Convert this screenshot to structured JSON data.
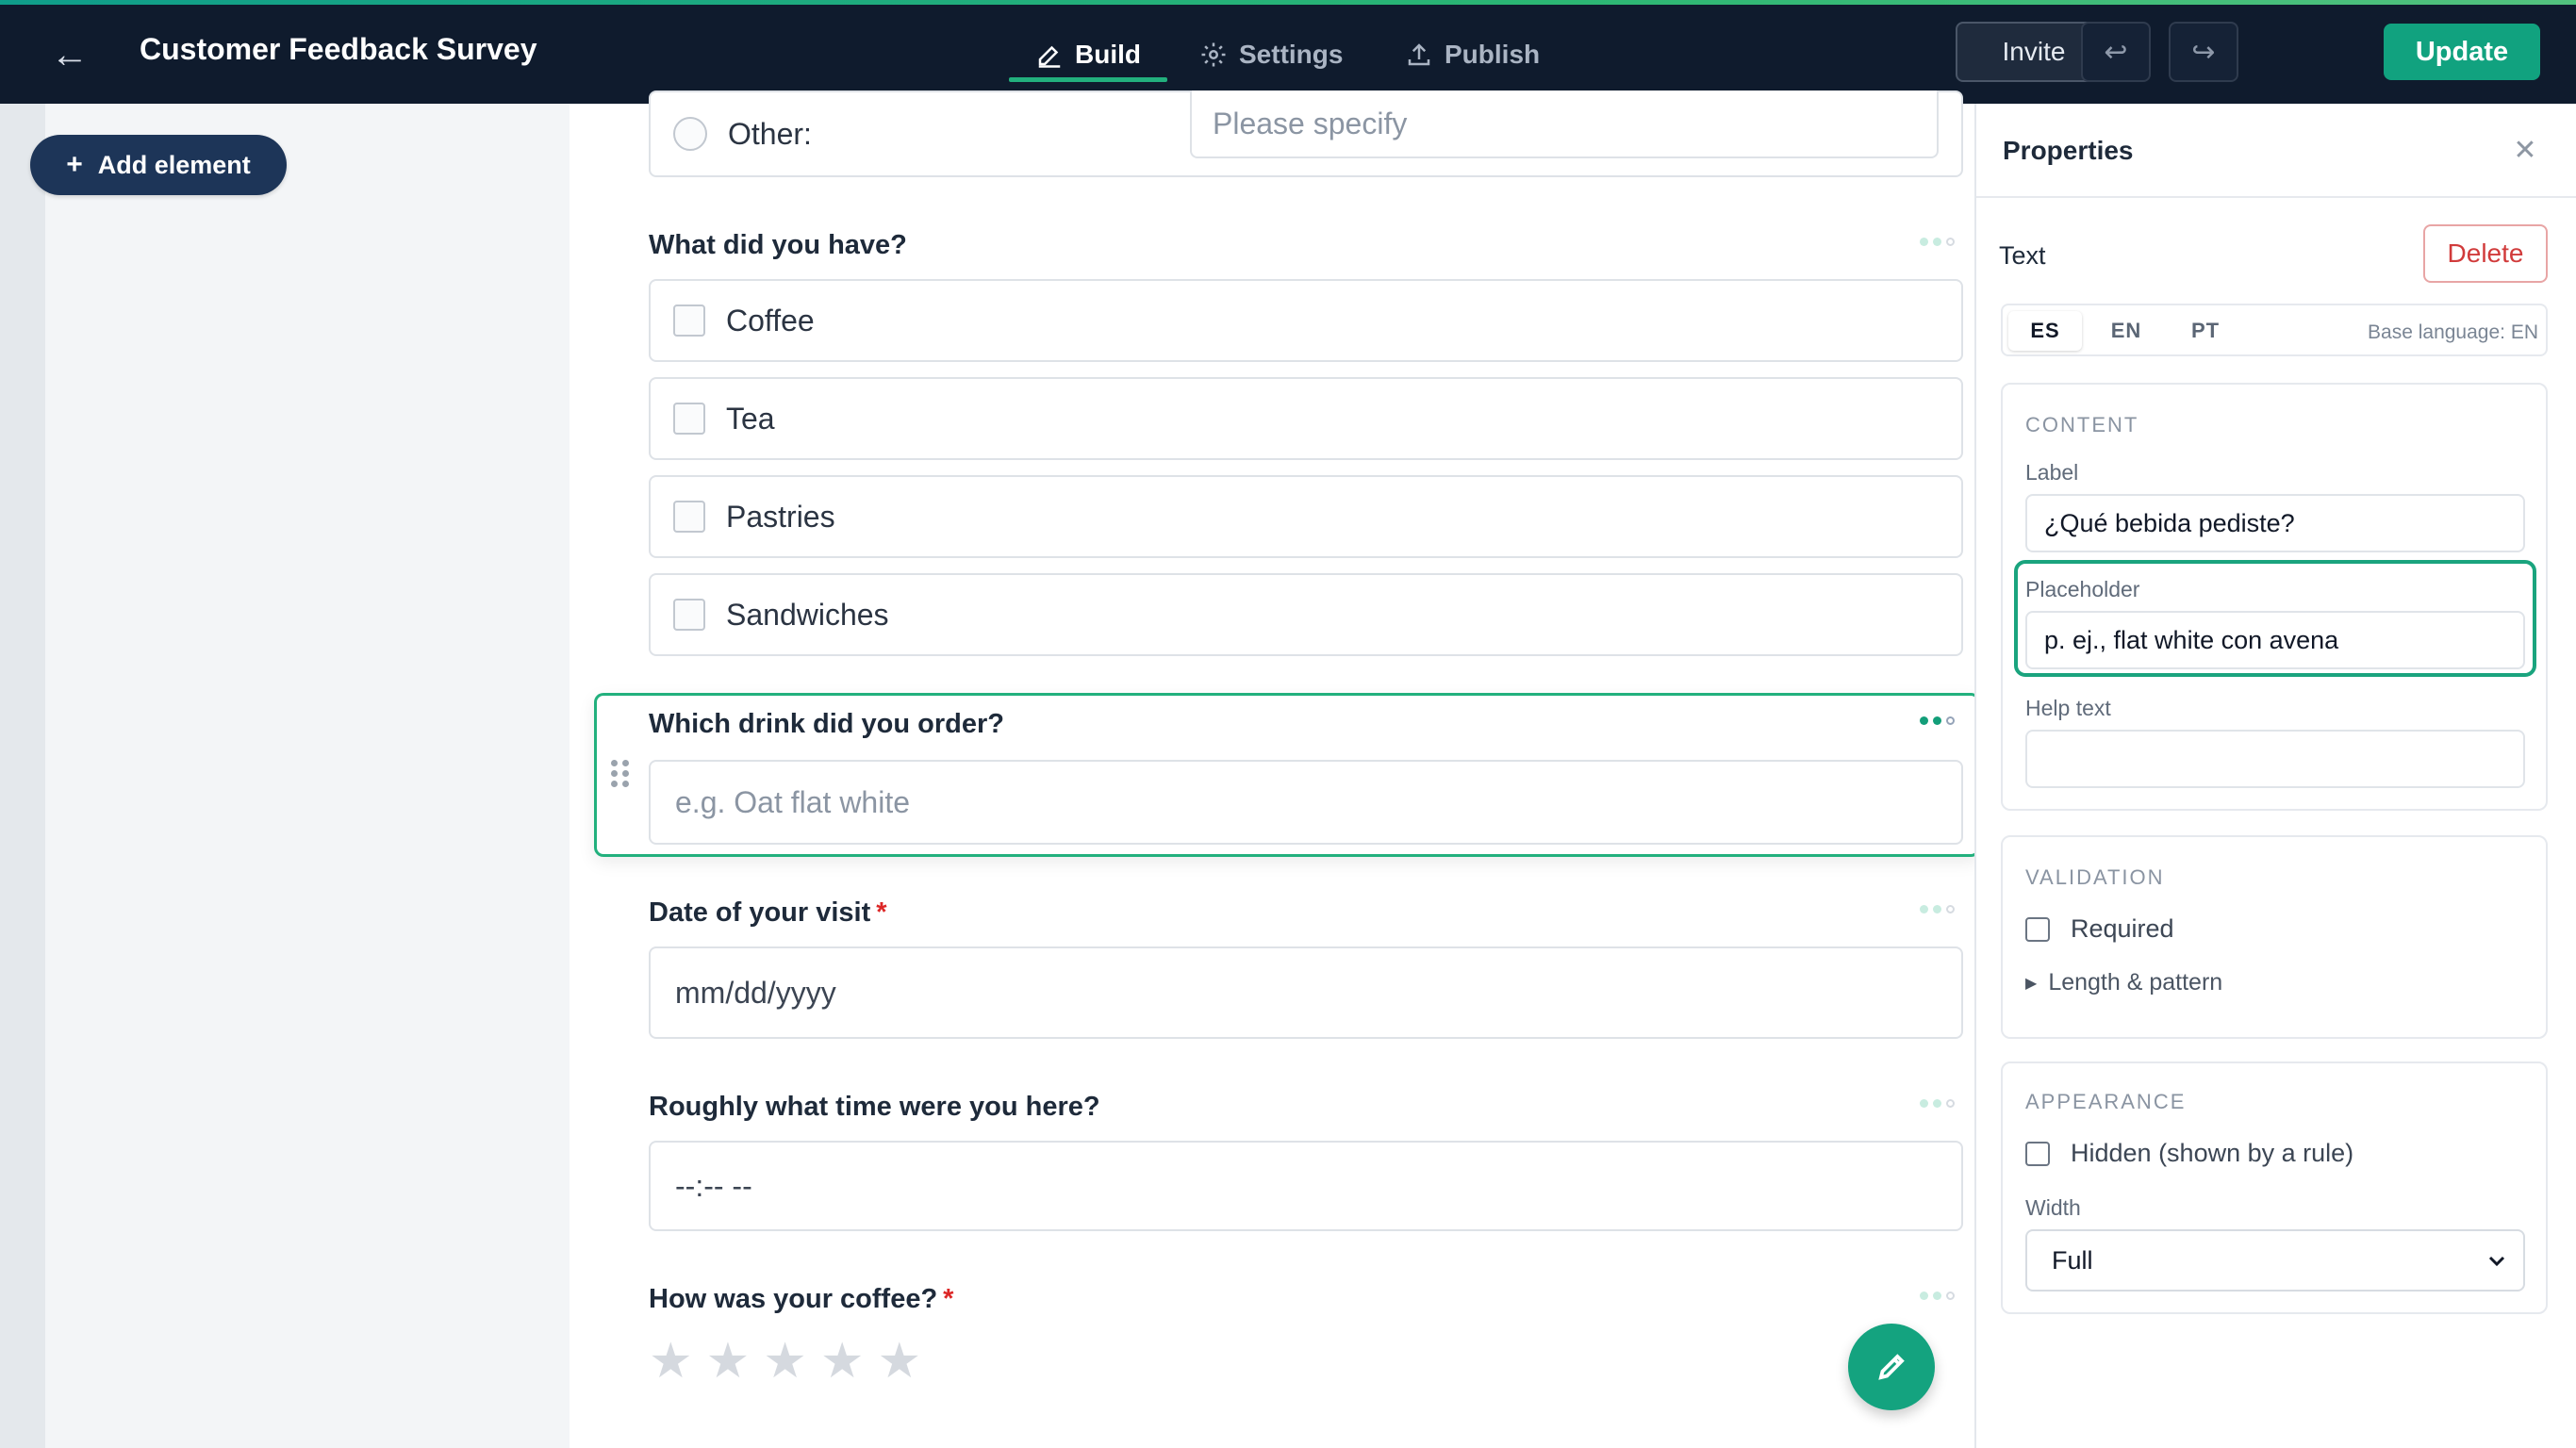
{
  "topbar": {
    "title": "Customer Feedback Survey",
    "tabs": [
      {
        "label": "Build",
        "icon": "pencil-icon",
        "active": true
      },
      {
        "label": "Settings",
        "icon": "gear-icon",
        "active": false
      },
      {
        "label": "Publish",
        "icon": "upload-icon",
        "active": false
      }
    ],
    "invite_label": "Invite",
    "update_label": "Update",
    "accent_color": "#11a27f"
  },
  "left": {
    "add_element_label": "Add element"
  },
  "form": {
    "other": {
      "label": "Other:",
      "placeholder": "Please specify"
    },
    "q_have": {
      "label": "What did you have?",
      "options": [
        "Coffee",
        "Tea",
        "Pastries",
        "Sandwiches"
      ]
    },
    "q_drink": {
      "label": "Which drink did you order?",
      "placeholder": "e.g. Oat flat white"
    },
    "q_date": {
      "label": "Date of your visit",
      "required_mark": "*",
      "value": "mm/dd/yyyy"
    },
    "q_time": {
      "label": "Roughly what time were you here?",
      "value": "--:-- --"
    },
    "q_coffee": {
      "label": "How was your coffee?",
      "required_mark": "*",
      "stars": 5,
      "rating": 0
    }
  },
  "properties": {
    "title": "Properties",
    "type": "Text",
    "delete_label": "Delete",
    "languages": [
      "ES",
      "EN",
      "PT"
    ],
    "active_language": "ES",
    "base_language": "Base language: EN",
    "content": {
      "heading": "CONTENT",
      "label_label": "Label",
      "label_value": "¿Qué bebida pediste?",
      "placeholder_label": "Placeholder",
      "placeholder_value": "p. ej., flat white con avena",
      "help_label": "Help text",
      "help_value": ""
    },
    "validation": {
      "heading": "VALIDATION",
      "required_label": "Required",
      "length_label": "Length & pattern"
    },
    "appearance": {
      "heading": "APPEARANCE",
      "hidden_label": "Hidden (shown by a rule)",
      "width_label": "Width",
      "width_value": "Full"
    }
  }
}
